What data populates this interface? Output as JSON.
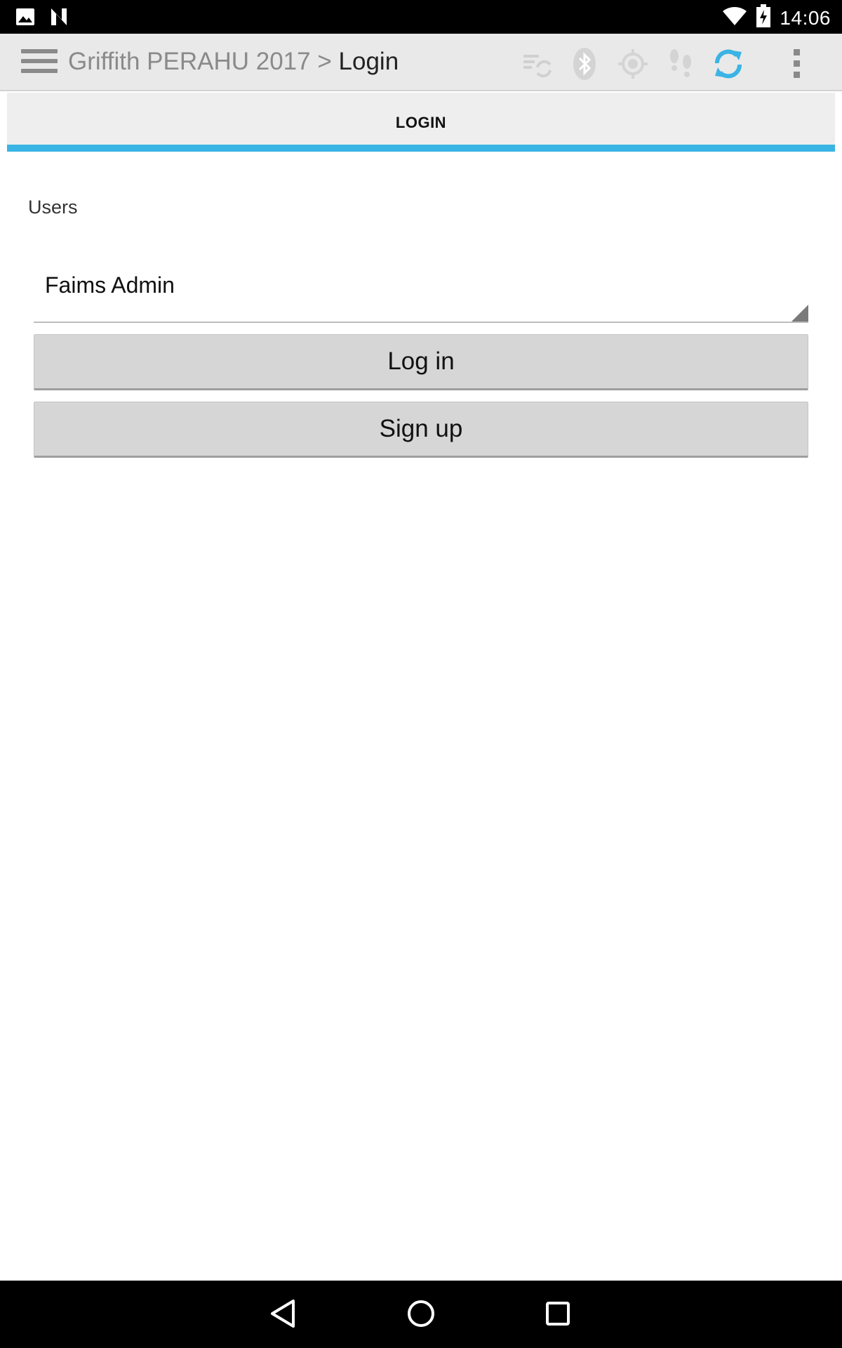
{
  "status_bar": {
    "time": "14:06",
    "left_icons": [
      "image-notification-icon",
      "n-notification-icon"
    ],
    "right_icons": [
      "wifi-icon",
      "battery-charging-icon"
    ]
  },
  "action_bar": {
    "module_title": "Griffith PERAHU 2017",
    "separator": ">",
    "page_title": "Login",
    "icons": [
      "menu-icon",
      "sync-list-icon",
      "bluetooth-icon",
      "gps-icon",
      "tracking-icon",
      "sync-icon",
      "overflow-menu-icon"
    ],
    "accent_color": "#3ab4e4"
  },
  "tabs": [
    {
      "label": "LOGIN",
      "selected": true
    }
  ],
  "login": {
    "users_label": "Users",
    "selected_user": "Faims Admin",
    "login_button": "Log in",
    "signup_button": "Sign up"
  },
  "nav_bar": {
    "icons": [
      "back-icon",
      "home-icon",
      "recents-icon"
    ]
  }
}
